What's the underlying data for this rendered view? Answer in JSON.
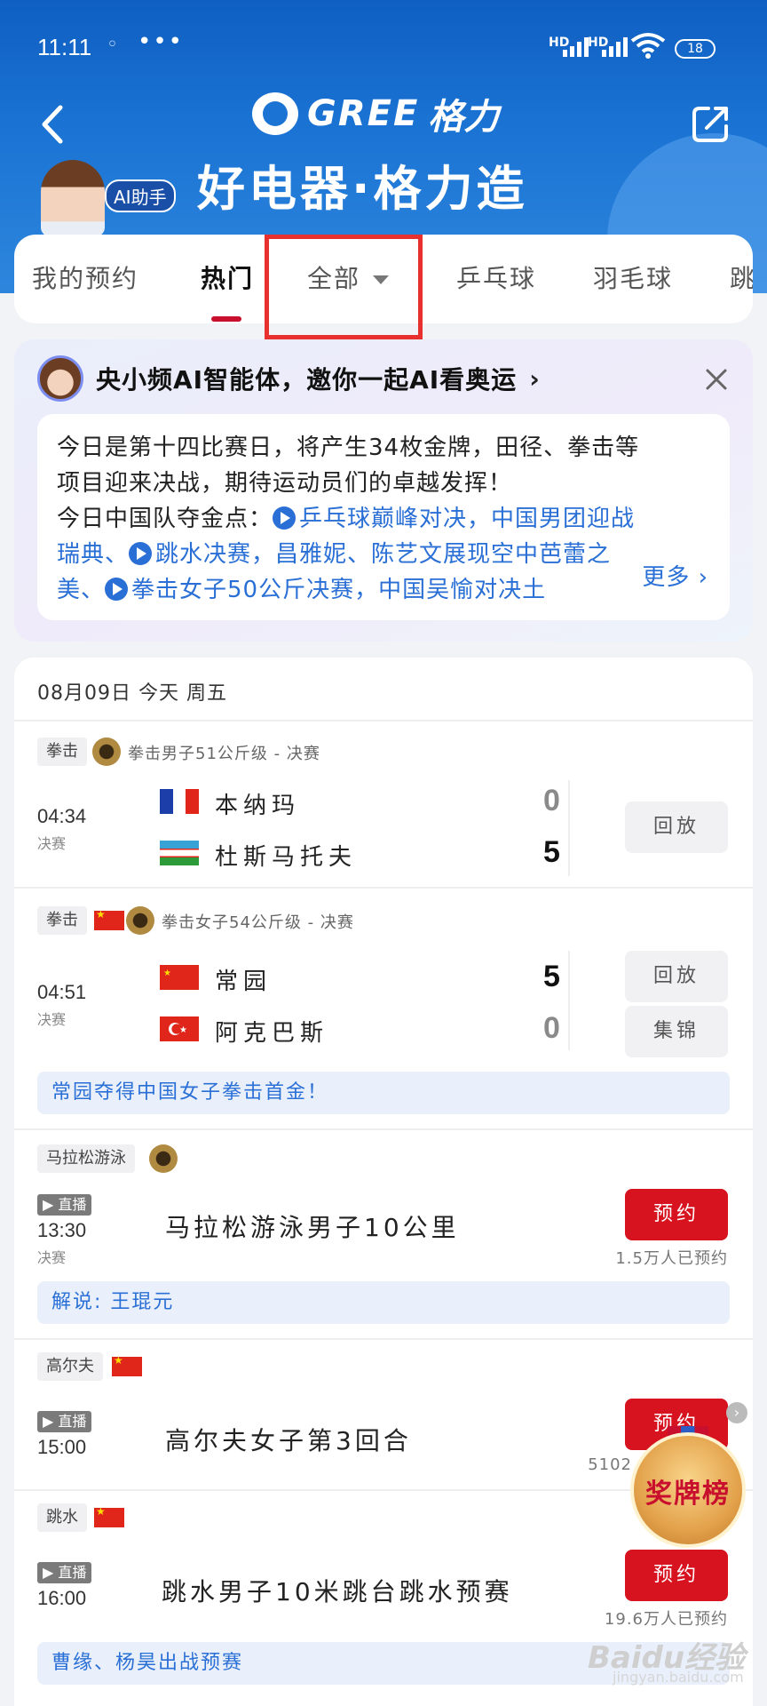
{
  "status": {
    "time": "11:11",
    "dots": "•••",
    "net1": "HD",
    "net2": "HD",
    "battery": "18"
  },
  "header": {
    "brand": "GREE",
    "brand_cn": "格力",
    "slogan": "好电器·格力造",
    "ai_badge": "AI助手"
  },
  "tabs": [
    {
      "label": "我的预约"
    },
    {
      "label": "热门"
    },
    {
      "label": "全部"
    },
    {
      "label": "乒乓球"
    },
    {
      "label": "羽毛球"
    },
    {
      "label": "跳"
    }
  ],
  "ai_card": {
    "title": "央小频AI智能体，邀你一起AI看奥运",
    "line1": "今日是第十四比赛日，将产生34枚金牌，田径、拳击等",
    "line2": "项目迎来决战，期待运动员们的卓越发挥！",
    "line3_prefix": "今日中国队夺金点：",
    "link1": "乒乓球巅峰对决，中国男团迎战",
    "link1b": "瑞典、",
    "link2": "跳水决赛，昌雅妮、陈艺文展现空中芭蕾之",
    "link2b": "美、",
    "link3": "拳击女子50公斤决赛，中国吴愉对决土",
    "more": "更多"
  },
  "date_header": "08月09日 今天 周五",
  "events": [
    {
      "sport": "拳击",
      "name": "拳击男子51公斤级 - 决赛",
      "time": "04:34",
      "stage": "决赛",
      "team1": "本纳玛",
      "score1": "0",
      "team2": "杜斯马托夫",
      "score2": "5",
      "btn1": "回放"
    },
    {
      "sport": "拳击",
      "name": "拳击女子54公斤级 - 决赛",
      "time": "04:51",
      "stage": "决赛",
      "team1": "常园",
      "score1": "5",
      "team2": "阿克巴斯",
      "score2": "0",
      "btn1": "回放",
      "btn2": "集锦",
      "note": "常园夺得中国女子拳击首金！"
    },
    {
      "sport": "马拉松游泳",
      "live": "▶ 直播",
      "time": "13:30",
      "stage": "决赛",
      "title": "马拉松游泳男子10公里",
      "btn": "预约",
      "booked": "1.5万人已预约",
      "note": "解说: 王琨元"
    },
    {
      "sport": "高尔夫",
      "live": "▶ 直播",
      "time": "15:00",
      "title": "高尔夫女子第3回合",
      "btn": "预约",
      "booked": "5102"
    },
    {
      "sport": "跳水",
      "live": "▶ 直播",
      "time": "16:00",
      "title": "跳水男子10米跳台跳水预赛",
      "btn": "预约",
      "booked": "19.6万人已预约",
      "note": "曹缘、杨昊出战预赛"
    }
  ],
  "medal_rank": "奖牌榜",
  "watermark": "Baidu经验",
  "watermark_sub": "jingyan.baidu.com",
  "colors": {
    "header_blue": "#1b74d4",
    "accent_red": "#d7131f",
    "link_blue": "#2a6fd6",
    "highlight_box": "#e8312f"
  }
}
